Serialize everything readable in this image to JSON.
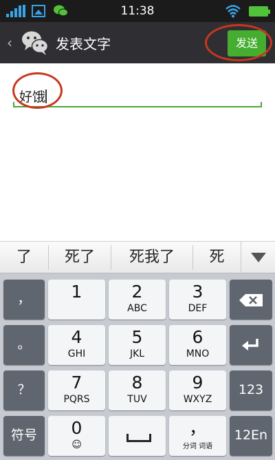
{
  "status_bar": {
    "time": "11:38",
    "icons": [
      "signal-icon",
      "picture-notification-icon",
      "wechat-notification-icon",
      "wifi-icon",
      "battery-icon"
    ]
  },
  "header": {
    "back_icon": "‹",
    "title": "发表文字",
    "send_label": "发送"
  },
  "composer": {
    "text": "好饿"
  },
  "candidates": [
    "了",
    "死了",
    "死我了",
    "死"
  ],
  "keyboard": {
    "rows": [
      [
        {
          "type": "fn",
          "label": "，"
        },
        {
          "type": "num",
          "number": "1",
          "letters": ""
        },
        {
          "type": "num",
          "number": "2",
          "letters": "ABC"
        },
        {
          "type": "num",
          "number": "3",
          "letters": "DEF"
        },
        {
          "type": "fn",
          "icon": "backspace-icon"
        }
      ],
      [
        {
          "type": "fn",
          "label": "。"
        },
        {
          "type": "num",
          "number": "4",
          "letters": "GHI"
        },
        {
          "type": "num",
          "number": "5",
          "letters": "JKL"
        },
        {
          "type": "num",
          "number": "6",
          "letters": "MNO"
        },
        {
          "type": "fn",
          "icon": "enter-icon"
        }
      ],
      [
        {
          "type": "fn",
          "label": "？"
        },
        {
          "type": "num",
          "number": "7",
          "letters": "PQRS"
        },
        {
          "type": "num",
          "number": "8",
          "letters": "TUV"
        },
        {
          "type": "num",
          "number": "9",
          "letters": "WXYZ"
        },
        {
          "type": "fn",
          "label": "123"
        }
      ],
      [
        {
          "type": "fn",
          "label": "符号"
        },
        {
          "type": "num",
          "number": "0",
          "letters": "☺"
        },
        {
          "type": "num",
          "icon": "space-icon"
        },
        {
          "type": "num",
          "number": "，",
          "letters": "分词 词语"
        },
        {
          "type": "fn",
          "label": "12En"
        }
      ]
    ]
  },
  "colors": {
    "accent_green": "#45ad2f",
    "annotation_red": "#c8361e",
    "header_bg": "#2f2f33",
    "status_blue": "#3aa4e9"
  }
}
